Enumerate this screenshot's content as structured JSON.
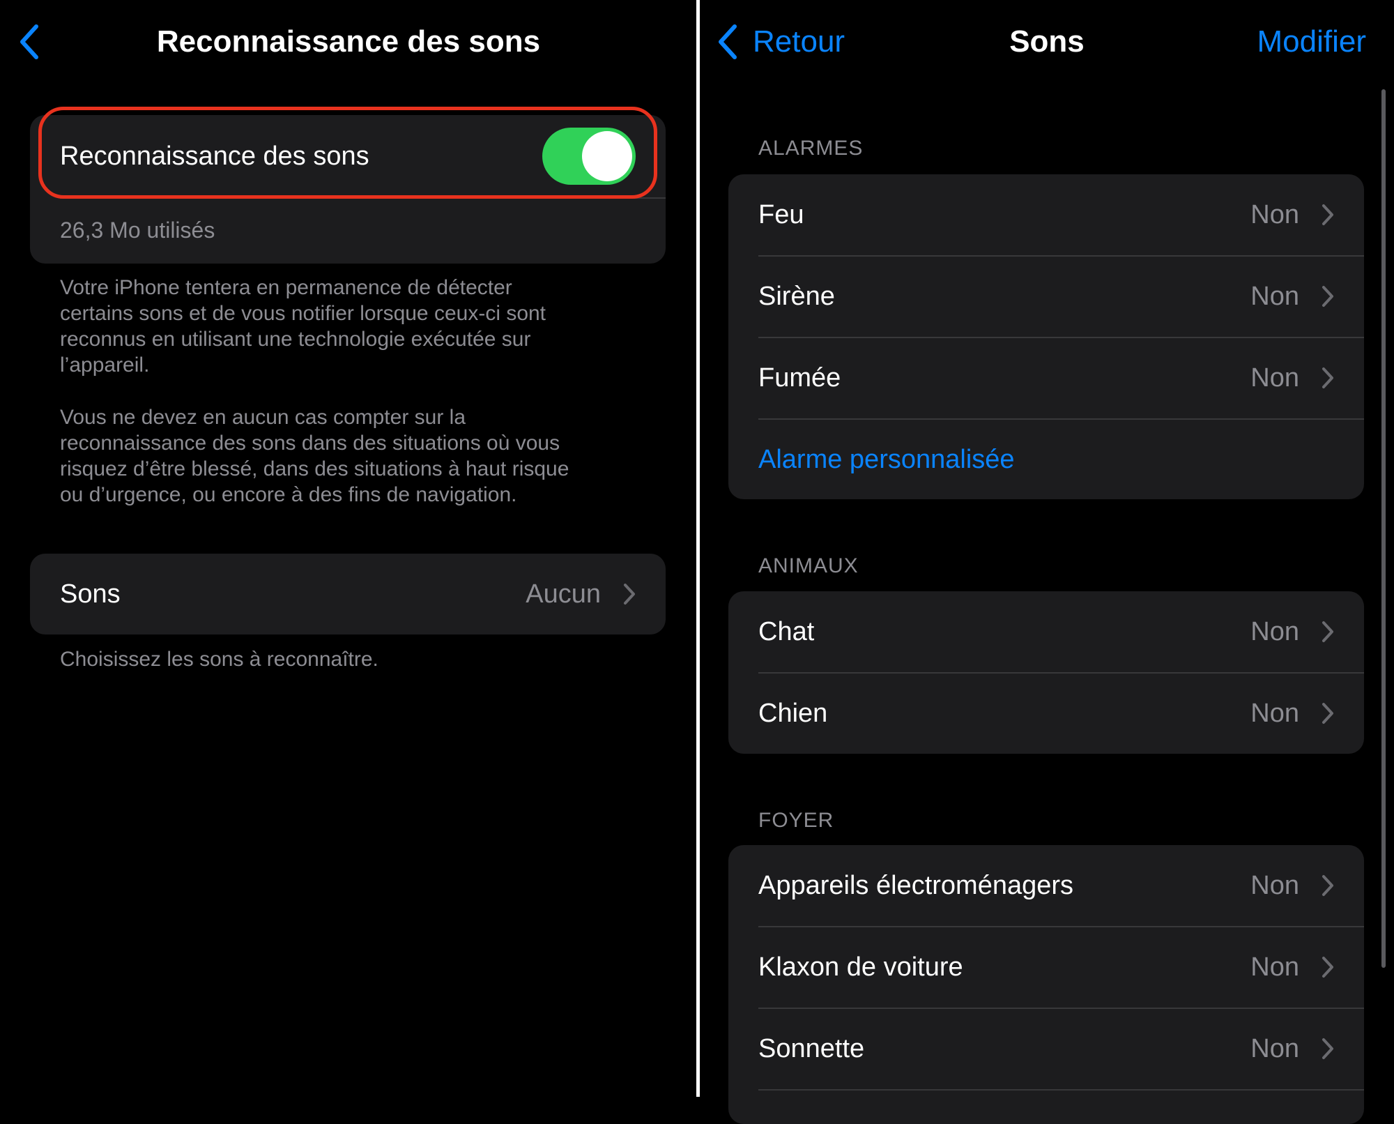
{
  "colors": {
    "background": "#000000",
    "group_bg": "#1c1c1e",
    "accent": "#0a84ff",
    "toggle_on": "#30d158",
    "secondary_text": "#8d8d93",
    "highlight": "#e8321e"
  },
  "left": {
    "back_icon": "chevron-left-icon",
    "title": "Reconnaissance des sons",
    "toggle_row": {
      "label": "Reconnaissance des sons",
      "state": true
    },
    "storage_text": "26,3 Mo utilisés",
    "description_1": "Votre iPhone tentera en permanence de détecter certains sons et de vous notifier lorsque ceux-ci sont reconnus en utilisant une technologie exécutée sur l’appareil.",
    "description_1_lines": [
      "Votre iPhone tentera en permanence de détecter",
      "certains sons et de vous notifier lorsque ceux-ci sont",
      "reconnus en utilisant une technologie exécutée sur",
      "l’appareil."
    ],
    "description_2_lines": [
      "Vous ne devez en aucun cas compter sur la",
      "reconnaissance des sons dans des situations où vous",
      "risquez d’être blessé, dans des situations à haut risque",
      "ou d’urgence, ou encore à des fins de navigation."
    ],
    "sounds_row": {
      "label": "Sons",
      "value": "Aucun"
    },
    "sounds_footer": "Choisissez les sons à reconnaître."
  },
  "right": {
    "back_label": "Retour",
    "title": "Sons",
    "edit_label": "Modifier",
    "sections": [
      {
        "header": "ALARMES",
        "items": [
          {
            "label": "Feu",
            "value": "Non"
          },
          {
            "label": "Sirène",
            "value": "Non"
          },
          {
            "label": "Fumée",
            "value": "Non"
          }
        ],
        "custom_link": "Alarme personnalisée"
      },
      {
        "header": "ANIMAUX",
        "items": [
          {
            "label": "Chat",
            "value": "Non"
          },
          {
            "label": "Chien",
            "value": "Non"
          }
        ]
      },
      {
        "header": "FOYER",
        "items": [
          {
            "label": "Appareils électroménagers",
            "value": "Non"
          },
          {
            "label": "Klaxon de voiture",
            "value": "Non"
          },
          {
            "label": "Sonnette",
            "value": "Non"
          }
        ]
      }
    ]
  }
}
